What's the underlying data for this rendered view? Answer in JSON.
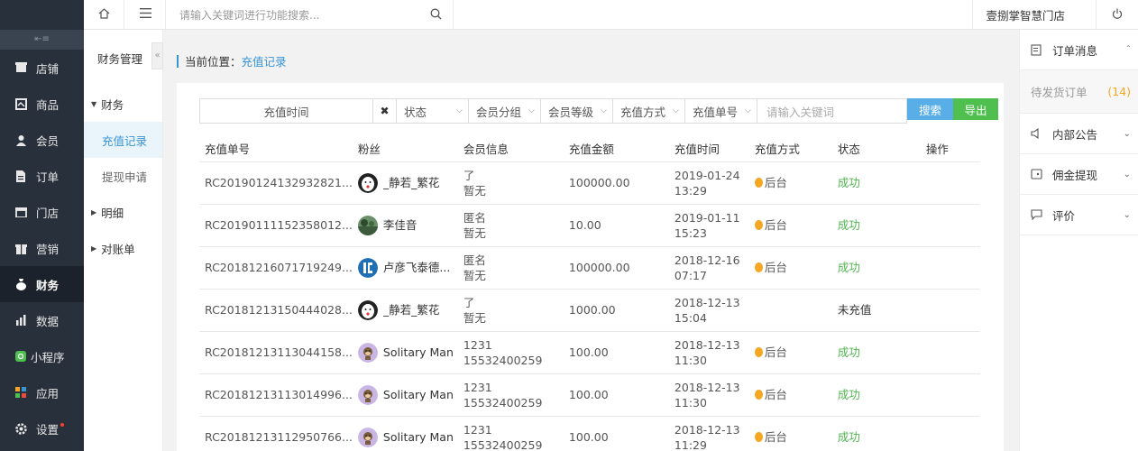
{
  "sidebar": {
    "items": [
      {
        "label": "店铺",
        "icon": "shop-icon"
      },
      {
        "label": "商品",
        "icon": "goods-icon"
      },
      {
        "label": "会员",
        "icon": "member-icon"
      },
      {
        "label": "订单",
        "icon": "order-icon"
      },
      {
        "label": "门店",
        "icon": "store-icon"
      },
      {
        "label": "营销",
        "icon": "marketing-icon"
      },
      {
        "label": "财务",
        "icon": "finance-icon",
        "active": true
      },
      {
        "label": "数据",
        "icon": "data-icon"
      },
      {
        "label": "小程序",
        "icon": "miniprogram-icon"
      },
      {
        "label": "应用",
        "icon": "apps-icon"
      },
      {
        "label": "设置",
        "icon": "settings-icon"
      }
    ]
  },
  "topbar": {
    "search_placeholder": "请输入关键词进行功能搜索...",
    "store_name": "壹捌掌智慧门店"
  },
  "subnav": {
    "title": "财务管理",
    "groups": [
      {
        "label": "财务"
      },
      {
        "label": "充值记录",
        "active": true
      },
      {
        "label": "提现申请"
      },
      {
        "label": "明细"
      },
      {
        "label": "对账单"
      }
    ]
  },
  "breadcrumb": {
    "prefix": "当前位置：",
    "current": "充值记录"
  },
  "filters": {
    "time": "充值时间",
    "selects": [
      "状态",
      "会员分组",
      "会员等级",
      "充值方式",
      "充值单号"
    ],
    "keyword_placeholder": "请输入关键词",
    "search_label": "搜索",
    "export_label": "导出"
  },
  "table": {
    "headers": [
      "充值单号",
      "粉丝",
      "会员信息",
      "充值金额",
      "充值时间",
      "充值方式",
      "状态",
      "操作"
    ],
    "rows": [
      {
        "no": "RC20190124132932821...",
        "fan": "_静若_繁花",
        "avatar": "clown",
        "info1": "了",
        "info2": "暂无",
        "amount": "100000.00",
        "date": "2019-01-24",
        "time": "13:29",
        "method": "后台",
        "status": "成功"
      },
      {
        "no": "RC20190111152358012...",
        "fan": "李佳音",
        "avatar": "landscape",
        "info1": "匿名",
        "info2": "暂无",
        "amount": "10.00",
        "date": "2019-01-11",
        "time": "15:23",
        "method": "后台",
        "status": "成功"
      },
      {
        "no": "RC20181216071719249...",
        "fan": "卢彦飞泰德...",
        "avatar": "logo",
        "info1": "匿名",
        "info2": "暂无",
        "amount": "100000.00",
        "date": "2018-12-16",
        "time": "07:17",
        "method": "后台",
        "status": "成功"
      },
      {
        "no": "RC20181213150444028...",
        "fan": "_静若_繁花",
        "avatar": "clown",
        "info1": "了",
        "info2": "暂无",
        "amount": "1000.00",
        "date": "2018-12-13",
        "time": "15:04",
        "method": "",
        "status": "未充值"
      },
      {
        "no": "RC20181213113044158...",
        "fan": "Solitary Man",
        "avatar": "monkey",
        "info1": "1231",
        "info2": "15532400259",
        "amount": "100.00",
        "date": "2018-12-13",
        "time": "11:30",
        "method": "后台",
        "status": "成功"
      },
      {
        "no": "RC20181213113014996...",
        "fan": "Solitary Man",
        "avatar": "monkey",
        "info1": "1231",
        "info2": "15532400259",
        "amount": "100.00",
        "date": "2018-12-13",
        "time": "11:30",
        "method": "后台",
        "status": "成功"
      },
      {
        "no": "RC20181213112950766...",
        "fan": "Solitary Man",
        "avatar": "monkey",
        "info1": "1231",
        "info2": "15532400259",
        "amount": "100.00",
        "date": "2018-12-13",
        "time": "11:29",
        "method": "后台",
        "status": "成功"
      }
    ]
  },
  "rpanel": {
    "order_msg": "订单消息",
    "pending_label": "待发货订单",
    "pending_count": "(14)",
    "notice": "内部公告",
    "commission": "佣金提现",
    "review": "评价"
  },
  "colors": {
    "accent": "#3a94d4",
    "success": "#4fb54f",
    "export": "#4fc04f",
    "sidebar": "#28303b"
  }
}
